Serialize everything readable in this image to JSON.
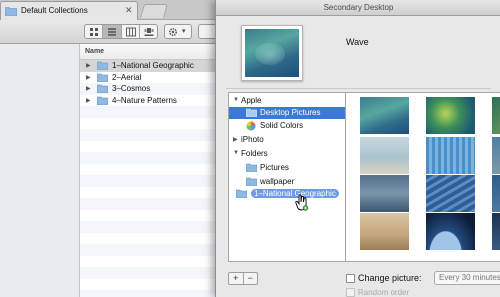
{
  "finder": {
    "tab_title": "Default Collections",
    "tab_close": "✕",
    "column_header": "Name",
    "rows": [
      {
        "label": "1–National Geographic",
        "selected": true
      },
      {
        "label": "2–Aerial"
      },
      {
        "label": "3–Cosmos"
      },
      {
        "label": "4–Nature Patterns"
      }
    ]
  },
  "prefs": {
    "window_title": "Secondary Desktop",
    "current_wallpaper": "Wave",
    "sources": {
      "apple_group": "Apple",
      "desktop_pictures": "Desktop Pictures",
      "solid_colors": "Solid Colors",
      "iphoto": "iPhoto",
      "folders_group": "Folders",
      "pictures": "Pictures",
      "wallpaper": "wallpaper",
      "dropped_folder": "1–National Geographic"
    },
    "add_button": "+",
    "remove_button": "−",
    "change_picture_label": "Change picture:",
    "interval_value": "Every 30 minutes",
    "random_order_label": "Random order"
  },
  "colors": {
    "selection": "#3b79d9",
    "folder": "#8fb9e3"
  }
}
